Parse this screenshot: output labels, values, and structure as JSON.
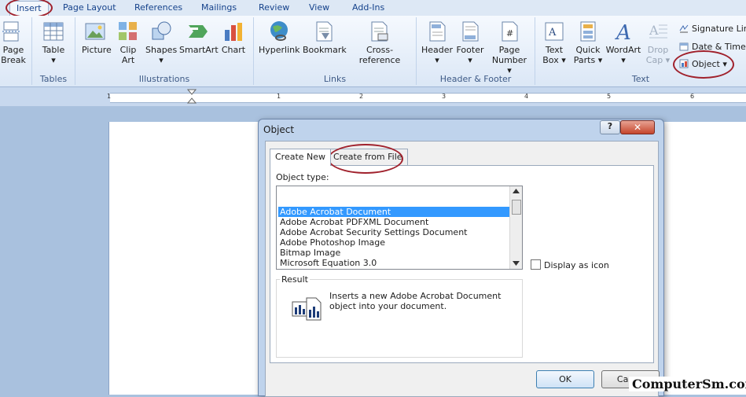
{
  "ribbon_tabs": [
    "Insert",
    "Page Layout",
    "References",
    "Mailings",
    "Review",
    "View",
    "Add-Ins"
  ],
  "groups": {
    "tables": "Tables",
    "illustrations": "Illustrations",
    "links": "Links",
    "header_footer": "Header & Footer",
    "text": "Text"
  },
  "buttons": {
    "page_break_1": "Page",
    "page_break_2": "Break",
    "table": "Table",
    "picture": "Picture",
    "clip_art_1": "Clip",
    "clip_art_2": "Art",
    "shapes": "Shapes",
    "smartart": "SmartArt",
    "chart": "Chart",
    "hyperlink": "Hyperlink",
    "bookmark": "Bookmark",
    "cross_reference": "Cross-reference",
    "header": "Header",
    "footer": "Footer",
    "page_number_1": "Page",
    "page_number_2": "Number",
    "text_box_1": "Text",
    "text_box_2": "Box",
    "quick_parts_1": "Quick",
    "quick_parts_2": "Parts",
    "wordart": "WordArt",
    "drop_cap_1": "Drop",
    "drop_cap_2": "Cap",
    "signature_line": "Signature Lin",
    "date_time": "Date & Time",
    "object": "Object"
  },
  "ruler_numbers": [
    "1",
    "1",
    "2",
    "3",
    "4",
    "5",
    "6"
  ],
  "dialog": {
    "title": "Object",
    "help": "?",
    "close": "✕",
    "tab_create_new": "Create New",
    "tab_create_from_file": "Create from File",
    "object_type_label": "Object type:",
    "object_types": [
      "Adobe Acrobat Document",
      "Adobe Acrobat PDFXML Document",
      "Adobe Acrobat Security Settings Document",
      "Adobe Photoshop Image",
      "Bitmap Image",
      "Microsoft Equation 3.0"
    ],
    "selected_index": 0,
    "display_as_icon": "Display as icon",
    "result_label": "Result",
    "result_text": "Inserts a new Adobe Acrobat Document object into your document.",
    "ok": "OK",
    "cancel": "Cance"
  },
  "watermark": "ComputerSm.com",
  "colors": {
    "annotation_circle": "#a0212c",
    "selection": "#3399ff",
    "ribbon_text": "#15428b"
  }
}
